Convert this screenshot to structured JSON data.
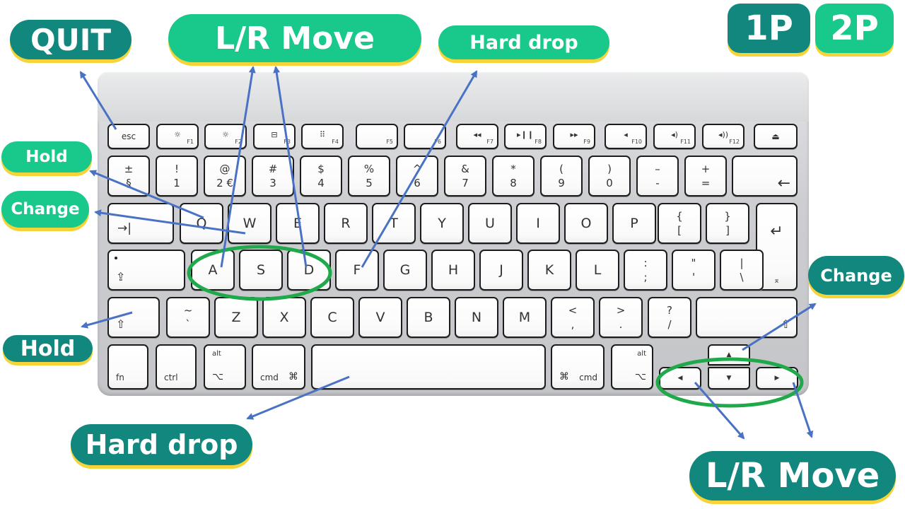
{
  "pills": {
    "quit": "QUIT",
    "lr_move_top": "L/R Move",
    "hard_drop_top": "Hard drop",
    "p1": "1P",
    "p2": "2P",
    "hold_left_top": "Hold",
    "change_left": "Change",
    "change_right": "Change",
    "hold_left_bottom": "Hold",
    "hard_drop_bottom": "Hard drop",
    "lr_move_bottom": "L/R Move"
  },
  "keys": {
    "esc": "esc",
    "f1": "F1",
    "f2": "F2",
    "f3": "F3",
    "f4": "F4",
    "f5": "F5",
    "f6": "F6",
    "f7": "F7",
    "f8": "F8",
    "f9": "F9",
    "f10": "F10",
    "f11": "F11",
    "f12": "F12",
    "f1_icon": "☼",
    "f2_icon": "☼",
    "f3_icon": "⊟",
    "f4_icon": "⠿",
    "f7_icon": "◂◂",
    "f8_icon": "▸❙❙",
    "f9_icon": "▸▸",
    "f10_icon": "◂",
    "f11_icon": "◂)",
    "f12_icon": "◂))",
    "eject": "⏏",
    "num_row": [
      {
        "top": "±",
        "bottom": "§"
      },
      {
        "top": "!",
        "bottom": "1"
      },
      {
        "top": "@",
        "bottom": "2 €"
      },
      {
        "top": "#",
        "bottom": "3"
      },
      {
        "top": "$",
        "bottom": "4"
      },
      {
        "top": "%",
        "bottom": "5"
      },
      {
        "top": "^",
        "bottom": "6"
      },
      {
        "top": "&",
        "bottom": "7"
      },
      {
        "top": "*",
        "bottom": "8"
      },
      {
        "top": "(",
        "bottom": "9"
      },
      {
        "top": ")",
        "bottom": "0"
      },
      {
        "top": "–",
        "bottom": "-"
      },
      {
        "top": "+",
        "bottom": "="
      }
    ],
    "backspace": "←",
    "tab": "→|",
    "row_q": [
      "Q",
      "W",
      "E",
      "R",
      "T",
      "Y",
      "U",
      "I",
      "O",
      "P"
    ],
    "bracket_l": {
      "top": "{",
      "bottom": "["
    },
    "bracket_r": {
      "top": "}",
      "bottom": "]"
    },
    "enter": "↵",
    "caps": "⇪",
    "row_a": [
      "A",
      "S",
      "D",
      "F",
      "G",
      "H",
      "J",
      "K",
      "L"
    ],
    "semicolon": {
      "top": ":",
      "bottom": ";"
    },
    "quote": {
      "top": "\"",
      "bottom": "'"
    },
    "backslash": {
      "top": "|",
      "bottom": "\\"
    },
    "enter_sym": "⌅",
    "shift_l": "⇧",
    "tilde": {
      "top": "~",
      "bottom": "`"
    },
    "row_z": [
      "Z",
      "X",
      "C",
      "V",
      "B",
      "N",
      "M"
    ],
    "comma": {
      "top": "<",
      "bottom": ","
    },
    "period": {
      "top": ">",
      "bottom": "."
    },
    "slash": {
      "top": "?",
      "bottom": "/"
    },
    "shift_r": "⇧",
    "fn": "fn",
    "ctrl": "ctrl",
    "alt": "alt",
    "option_sym": "⌥",
    "cmd": "cmd",
    "cmd_sym": "⌘",
    "arrow_up": "▲",
    "arrow_left": "◀",
    "arrow_down": "▼",
    "arrow_right": "▶"
  },
  "colors": {
    "pill_dark": "#11877d",
    "pill_light": "#19c98c",
    "pill_shadow": "#f5d33a",
    "arrow_line": "#4a72c4",
    "highlight_ring": "#1fa94a"
  }
}
